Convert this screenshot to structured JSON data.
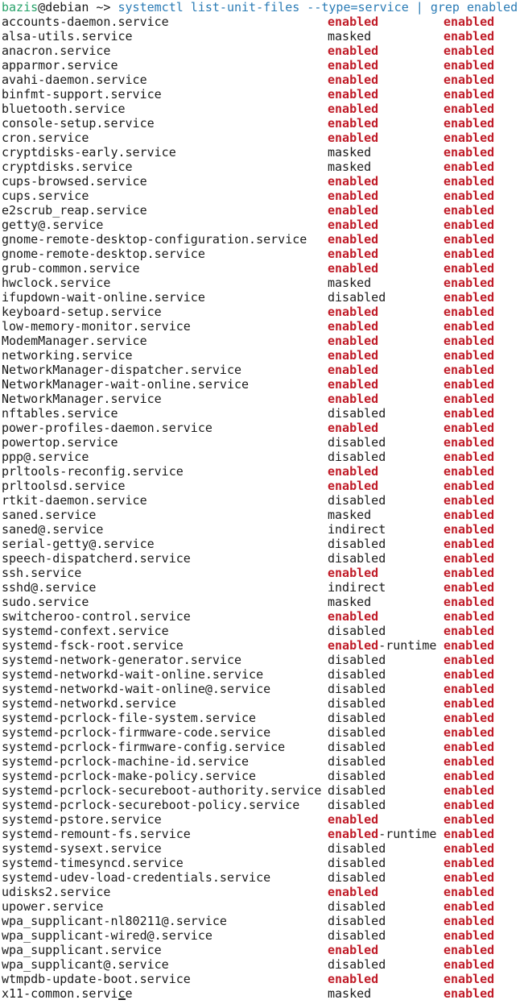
{
  "prompt": {
    "user": "bazis",
    "at_host": "@debian ~> ",
    "command": "systemctl list-unit-files --type=service | grep ",
    "grep_term": "enabled"
  },
  "rows": [
    {
      "name": "accounts-daemon.service",
      "state": "enabled",
      "state_suffix": "",
      "preset": "enabled"
    },
    {
      "name": "alsa-utils.service",
      "state": "masked",
      "state_suffix": "",
      "preset": "enabled"
    },
    {
      "name": "anacron.service",
      "state": "enabled",
      "state_suffix": "",
      "preset": "enabled"
    },
    {
      "name": "apparmor.service",
      "state": "enabled",
      "state_suffix": "",
      "preset": "enabled"
    },
    {
      "name": "avahi-daemon.service",
      "state": "enabled",
      "state_suffix": "",
      "preset": "enabled"
    },
    {
      "name": "binfmt-support.service",
      "state": "enabled",
      "state_suffix": "",
      "preset": "enabled"
    },
    {
      "name": "bluetooth.service",
      "state": "enabled",
      "state_suffix": "",
      "preset": "enabled"
    },
    {
      "name": "console-setup.service",
      "state": "enabled",
      "state_suffix": "",
      "preset": "enabled"
    },
    {
      "name": "cron.service",
      "state": "enabled",
      "state_suffix": "",
      "preset": "enabled"
    },
    {
      "name": "cryptdisks-early.service",
      "state": "masked",
      "state_suffix": "",
      "preset": "enabled"
    },
    {
      "name": "cryptdisks.service",
      "state": "masked",
      "state_suffix": "",
      "preset": "enabled"
    },
    {
      "name": "cups-browsed.service",
      "state": "enabled",
      "state_suffix": "",
      "preset": "enabled"
    },
    {
      "name": "cups.service",
      "state": "enabled",
      "state_suffix": "",
      "preset": "enabled"
    },
    {
      "name": "e2scrub_reap.service",
      "state": "enabled",
      "state_suffix": "",
      "preset": "enabled"
    },
    {
      "name": "getty@.service",
      "state": "enabled",
      "state_suffix": "",
      "preset": "enabled"
    },
    {
      "name": "gnome-remote-desktop-configuration.service",
      "state": "enabled",
      "state_suffix": "",
      "preset": "enabled"
    },
    {
      "name": "gnome-remote-desktop.service",
      "state": "enabled",
      "state_suffix": "",
      "preset": "enabled"
    },
    {
      "name": "grub-common.service",
      "state": "enabled",
      "state_suffix": "",
      "preset": "enabled"
    },
    {
      "name": "hwclock.service",
      "state": "masked",
      "state_suffix": "",
      "preset": "enabled"
    },
    {
      "name": "ifupdown-wait-online.service",
      "state": "disabled",
      "state_suffix": "",
      "preset": "enabled"
    },
    {
      "name": "keyboard-setup.service",
      "state": "enabled",
      "state_suffix": "",
      "preset": "enabled"
    },
    {
      "name": "low-memory-monitor.service",
      "state": "enabled",
      "state_suffix": "",
      "preset": "enabled"
    },
    {
      "name": "ModemManager.service",
      "state": "enabled",
      "state_suffix": "",
      "preset": "enabled"
    },
    {
      "name": "networking.service",
      "state": "enabled",
      "state_suffix": "",
      "preset": "enabled"
    },
    {
      "name": "NetworkManager-dispatcher.service",
      "state": "enabled",
      "state_suffix": "",
      "preset": "enabled"
    },
    {
      "name": "NetworkManager-wait-online.service",
      "state": "enabled",
      "state_suffix": "",
      "preset": "enabled"
    },
    {
      "name": "NetworkManager.service",
      "state": "enabled",
      "state_suffix": "",
      "preset": "enabled"
    },
    {
      "name": "nftables.service",
      "state": "disabled",
      "state_suffix": "",
      "preset": "enabled"
    },
    {
      "name": "power-profiles-daemon.service",
      "state": "enabled",
      "state_suffix": "",
      "preset": "enabled"
    },
    {
      "name": "powertop.service",
      "state": "disabled",
      "state_suffix": "",
      "preset": "enabled"
    },
    {
      "name": "ppp@.service",
      "state": "disabled",
      "state_suffix": "",
      "preset": "enabled"
    },
    {
      "name": "prltools-reconfig.service",
      "state": "enabled",
      "state_suffix": "",
      "preset": "enabled"
    },
    {
      "name": "prltoolsd.service",
      "state": "enabled",
      "state_suffix": "",
      "preset": "enabled"
    },
    {
      "name": "rtkit-daemon.service",
      "state": "disabled",
      "state_suffix": "",
      "preset": "enabled"
    },
    {
      "name": "saned.service",
      "state": "masked",
      "state_suffix": "",
      "preset": "enabled"
    },
    {
      "name": "saned@.service",
      "state": "indirect",
      "state_suffix": "",
      "preset": "enabled"
    },
    {
      "name": "serial-getty@.service",
      "state": "disabled",
      "state_suffix": "",
      "preset": "enabled"
    },
    {
      "name": "speech-dispatcherd.service",
      "state": "disabled",
      "state_suffix": "",
      "preset": "enabled"
    },
    {
      "name": "ssh.service",
      "state": "enabled",
      "state_suffix": "",
      "preset": "enabled"
    },
    {
      "name": "sshd@.service",
      "state": "indirect",
      "state_suffix": "",
      "preset": "enabled"
    },
    {
      "name": "sudo.service",
      "state": "masked",
      "state_suffix": "",
      "preset": "enabled"
    },
    {
      "name": "switcheroo-control.service",
      "state": "enabled",
      "state_suffix": "",
      "preset": "enabled"
    },
    {
      "name": "systemd-confext.service",
      "state": "disabled",
      "state_suffix": "",
      "preset": "enabled"
    },
    {
      "name": "systemd-fsck-root.service",
      "state": "enabled",
      "state_suffix": "-runtime",
      "preset": "enabled"
    },
    {
      "name": "systemd-network-generator.service",
      "state": "disabled",
      "state_suffix": "",
      "preset": "enabled"
    },
    {
      "name": "systemd-networkd-wait-online.service",
      "state": "disabled",
      "state_suffix": "",
      "preset": "enabled"
    },
    {
      "name": "systemd-networkd-wait-online@.service",
      "state": "disabled",
      "state_suffix": "",
      "preset": "enabled"
    },
    {
      "name": "systemd-networkd.service",
      "state": "disabled",
      "state_suffix": "",
      "preset": "enabled"
    },
    {
      "name": "systemd-pcrlock-file-system.service",
      "state": "disabled",
      "state_suffix": "",
      "preset": "enabled"
    },
    {
      "name": "systemd-pcrlock-firmware-code.service",
      "state": "disabled",
      "state_suffix": "",
      "preset": "enabled"
    },
    {
      "name": "systemd-pcrlock-firmware-config.service",
      "state": "disabled",
      "state_suffix": "",
      "preset": "enabled"
    },
    {
      "name": "systemd-pcrlock-machine-id.service",
      "state": "disabled",
      "state_suffix": "",
      "preset": "enabled"
    },
    {
      "name": "systemd-pcrlock-make-policy.service",
      "state": "disabled",
      "state_suffix": "",
      "preset": "enabled"
    },
    {
      "name": "systemd-pcrlock-secureboot-authority.service",
      "state": "disabled",
      "state_suffix": "",
      "preset": "enabled"
    },
    {
      "name": "systemd-pcrlock-secureboot-policy.service",
      "state": "disabled",
      "state_suffix": "",
      "preset": "enabled"
    },
    {
      "name": "systemd-pstore.service",
      "state": "enabled",
      "state_suffix": "",
      "preset": "enabled"
    },
    {
      "name": "systemd-remount-fs.service",
      "state": "enabled",
      "state_suffix": "-runtime",
      "preset": "enabled"
    },
    {
      "name": "systemd-sysext.service",
      "state": "disabled",
      "state_suffix": "",
      "preset": "enabled"
    },
    {
      "name": "systemd-timesyncd.service",
      "state": "disabled",
      "state_suffix": "",
      "preset": "enabled"
    },
    {
      "name": "systemd-udev-load-credentials.service",
      "state": "disabled",
      "state_suffix": "",
      "preset": "enabled"
    },
    {
      "name": "udisks2.service",
      "state": "enabled",
      "state_suffix": "",
      "preset": "enabled"
    },
    {
      "name": "upower.service",
      "state": "disabled",
      "state_suffix": "",
      "preset": "enabled"
    },
    {
      "name": "wpa_supplicant-nl80211@.service",
      "state": "disabled",
      "state_suffix": "",
      "preset": "enabled"
    },
    {
      "name": "wpa_supplicant-wired@.service",
      "state": "disabled",
      "state_suffix": "",
      "preset": "enabled"
    },
    {
      "name": "wpa_supplicant.service",
      "state": "enabled",
      "state_suffix": "",
      "preset": "enabled"
    },
    {
      "name": "wpa_supplicant@.service",
      "state": "disabled",
      "state_suffix": "",
      "preset": "enabled"
    },
    {
      "name": "wtmpdb-update-boot.service",
      "state": "enabled",
      "state_suffix": "",
      "preset": "enabled"
    },
    {
      "name": "x11-common.service",
      "state": "masked",
      "state_suffix": "",
      "preset": "enabled"
    }
  ],
  "colors": {
    "prompt_user": "#26a269",
    "prompt_command": "#2a7bb5",
    "grep_match": "#c01c28",
    "text": "#1a1a1a",
    "background": "#ffffff"
  }
}
